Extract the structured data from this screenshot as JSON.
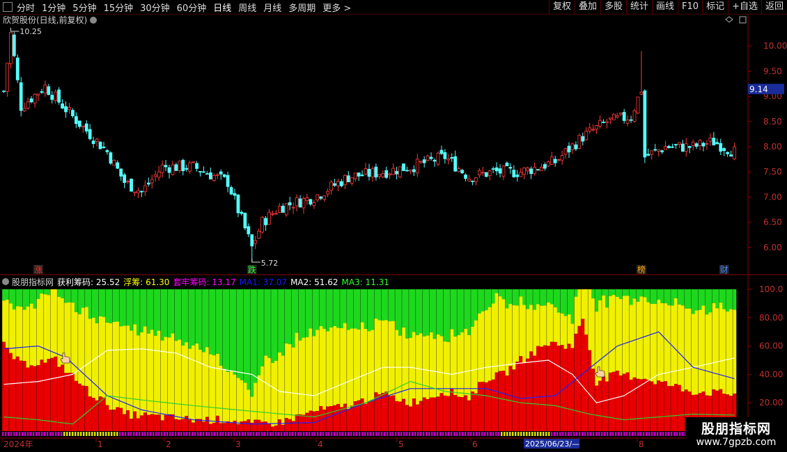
{
  "toolbar": {
    "left": [
      "分时",
      "1分钟",
      "5分钟",
      "15分钟",
      "30分钟",
      "60分钟",
      "日线",
      "周线",
      "月线",
      "多周期",
      "更多 >"
    ],
    "active": "日线",
    "right": [
      "复权",
      "叠加",
      "多股",
      "统计",
      "画线",
      "F10",
      "标记",
      "+自选",
      "返回"
    ]
  },
  "main_chart": {
    "title": "欣贺股份(日线,前复权)",
    "current_price_tag": "9.14",
    "high_label": "10.25",
    "low_label": "5.72",
    "markers": [
      {
        "text": "涨",
        "color": "#ff3030",
        "date_index": 10
      },
      {
        "text": "跌",
        "color": "#30ff30",
        "date_index": 72
      },
      {
        "text": "榜",
        "color": "#ffa500",
        "date_index": 185
      },
      {
        "text": "财",
        "color": "#4488ff",
        "date_index": 209
      }
    ]
  },
  "indicator": {
    "name": "股朋指标网",
    "items": [
      {
        "label": "获利筹码:",
        "value": "25.52",
        "color": "#ffffff"
      },
      {
        "label": "浮筹:",
        "value": "61.30",
        "color": "#ffff00"
      },
      {
        "label": "套牢筹码:",
        "value": "13.17",
        "color": "#ff00ff"
      },
      {
        "label": "MA1:",
        "value": "37.07",
        "color": "#1818ff"
      },
      {
        "label": "MA2:",
        "value": "51.62",
        "color": "#ffffff"
      },
      {
        "label": "MA3:",
        "value": "11.31",
        "color": "#30ff30"
      }
    ]
  },
  "time_axis": {
    "labels": [
      "2024年",
      "1",
      "2",
      "3",
      "4",
      "5",
      "6",
      "7",
      "8"
    ],
    "cursor_label": "2025/06/23/—"
  },
  "watermark": {
    "line1": "股朋指标网",
    "line2": "www.7gpzb.com"
  },
  "chart_data": {
    "type": "candlestick",
    "price_axis": {
      "ticks": [
        "10.00",
        "9.50",
        "9.00",
        "8.50",
        "8.00",
        "7.50",
        "7.00",
        "6.50",
        "6.00"
      ],
      "range": [
        5.5,
        10.5
      ]
    },
    "indicator_axis": {
      "ticks": [
        "100.0",
        "80.00",
        "60.00",
        "40.00",
        "20.00"
      ],
      "range": [
        0,
        100
      ]
    },
    "close_anchors": [
      [
        0,
        9.1
      ],
      [
        2,
        10.25
      ],
      [
        5,
        8.8
      ],
      [
        12,
        9.2
      ],
      [
        20,
        8.6
      ],
      [
        30,
        7.9
      ],
      [
        35,
        7.3
      ],
      [
        40,
        7.1
      ],
      [
        46,
        7.6
      ],
      [
        55,
        7.6
      ],
      [
        65,
        7.3
      ],
      [
        72,
        6.0
      ],
      [
        75,
        6.5
      ],
      [
        80,
        6.8
      ],
      [
        90,
        7.0
      ],
      [
        100,
        7.4
      ],
      [
        110,
        7.5
      ],
      [
        118,
        7.6
      ],
      [
        128,
        7.8
      ],
      [
        135,
        7.4
      ],
      [
        142,
        7.5
      ],
      [
        150,
        7.5
      ],
      [
        160,
        7.7
      ],
      [
        168,
        8.2
      ],
      [
        175,
        8.5
      ],
      [
        182,
        8.6
      ],
      [
        185,
        9.14
      ],
      [
        186,
        7.8
      ],
      [
        192,
        8.0
      ],
      [
        200,
        8.0
      ],
      [
        206,
        8.1
      ],
      [
        212,
        7.9
      ]
    ],
    "profit_anchors": [
      [
        0,
        60
      ],
      [
        5,
        47
      ],
      [
        15,
        50
      ],
      [
        25,
        27
      ],
      [
        35,
        12
      ],
      [
        45,
        10
      ],
      [
        55,
        8
      ],
      [
        65,
        8
      ],
      [
        72,
        5
      ],
      [
        80,
        6
      ],
      [
        90,
        14
      ],
      [
        100,
        18
      ],
      [
        110,
        26
      ],
      [
        118,
        20
      ],
      [
        128,
        28
      ],
      [
        135,
        24
      ],
      [
        140,
        37
      ],
      [
        145,
        40
      ],
      [
        150,
        50
      ],
      [
        158,
        62
      ],
      [
        165,
        60
      ],
      [
        168,
        80
      ],
      [
        172,
        35
      ],
      [
        178,
        40
      ],
      [
        185,
        38
      ],
      [
        200,
        28
      ],
      [
        212,
        26
      ]
    ],
    "float_anchors": [
      [
        0,
        30
      ],
      [
        10,
        45
      ],
      [
        20,
        50
      ],
      [
        30,
        60
      ],
      [
        40,
        60
      ],
      [
        50,
        55
      ],
      [
        60,
        50
      ],
      [
        72,
        20
      ],
      [
        76,
        45
      ],
      [
        85,
        55
      ],
      [
        95,
        56
      ],
      [
        105,
        52
      ],
      [
        112,
        50
      ],
      [
        120,
        47
      ],
      [
        128,
        40
      ],
      [
        135,
        47
      ],
      [
        142,
        55
      ],
      [
        150,
        40
      ],
      [
        158,
        28
      ],
      [
        165,
        20
      ],
      [
        172,
        55
      ],
      [
        180,
        55
      ],
      [
        190,
        57
      ],
      [
        200,
        58
      ],
      [
        212,
        61.3
      ]
    ],
    "ma1_anchors": [
      [
        0,
        58
      ],
      [
        10,
        60
      ],
      [
        18,
        52
      ],
      [
        30,
        25
      ],
      [
        40,
        15
      ],
      [
        55,
        8
      ],
      [
        72,
        5
      ],
      [
        90,
        6
      ],
      [
        105,
        20
      ],
      [
        118,
        30
      ],
      [
        128,
        30
      ],
      [
        140,
        30
      ],
      [
        150,
        23
      ],
      [
        160,
        25
      ],
      [
        178,
        60
      ],
      [
        190,
        70
      ],
      [
        200,
        45
      ],
      [
        212,
        37
      ]
    ],
    "ma2_anchors": [
      [
        0,
        33
      ],
      [
        10,
        35
      ],
      [
        20,
        40
      ],
      [
        30,
        57
      ],
      [
        40,
        58
      ],
      [
        50,
        55
      ],
      [
        60,
        45
      ],
      [
        72,
        40
      ],
      [
        80,
        28
      ],
      [
        90,
        25
      ],
      [
        100,
        35
      ],
      [
        110,
        45
      ],
      [
        118,
        45
      ],
      [
        130,
        40
      ],
      [
        140,
        45
      ],
      [
        150,
        48
      ],
      [
        158,
        50
      ],
      [
        165,
        40
      ],
      [
        172,
        20
      ],
      [
        180,
        25
      ],
      [
        190,
        40
      ],
      [
        200,
        45
      ],
      [
        212,
        51.6
      ]
    ],
    "ma3_anchors": [
      [
        0,
        10
      ],
      [
        10,
        8
      ],
      [
        20,
        5
      ],
      [
        30,
        25
      ],
      [
        40,
        22
      ],
      [
        55,
        18
      ],
      [
        72,
        14
      ],
      [
        90,
        10
      ],
      [
        105,
        20
      ],
      [
        118,
        35
      ],
      [
        128,
        28
      ],
      [
        140,
        25
      ],
      [
        150,
        20
      ],
      [
        160,
        18
      ],
      [
        170,
        12
      ],
      [
        180,
        8
      ],
      [
        190,
        10
      ],
      [
        200,
        12
      ],
      [
        212,
        11.3
      ]
    ],
    "num_bars": 213
  }
}
